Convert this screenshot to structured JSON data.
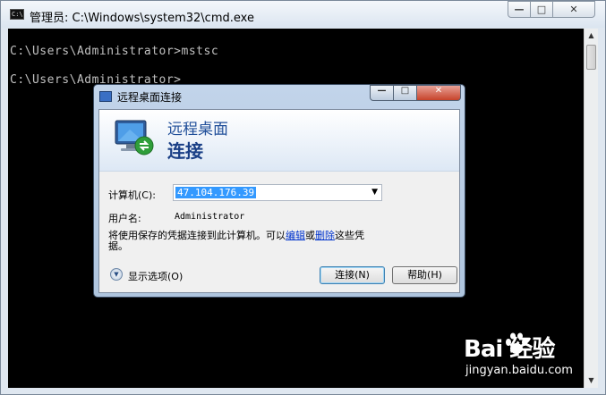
{
  "cmd_window": {
    "title": "管理员: C:\\Windows\\system32\\cmd.exe",
    "icon": "console-icon",
    "buttons": {
      "minimize": "—",
      "maximize": "□",
      "close": "✕"
    },
    "console_lines": [
      "C:\\Users\\Administrator>mstsc",
      "C:\\Users\\Administrator>"
    ]
  },
  "rdp_dialog": {
    "title": "远程桌面连接",
    "icon": "remote-desktop-icon",
    "heading_line1": "远程桌面",
    "heading_line2": "连接",
    "computer_label": "计算机(C):",
    "computer_value": "47.104.176.39",
    "username_label": "用户名:",
    "username_value": "Administrator",
    "info_text_before": "将使用保存的凭据连接到此计算机。可以",
    "info_link_edit": "编辑",
    "info_text_or": "或",
    "info_link_delete": "删除",
    "info_text_after": "这些凭据。",
    "options_label": "显示选项(O)",
    "connect_label": "连接(N)",
    "help_label": "帮助(H)",
    "buttons": {
      "minimize": "—",
      "maximize": "□",
      "close": "✕"
    }
  },
  "watermark": {
    "brand": "Bai  经验",
    "url": "jingyan.baidu.com"
  },
  "colors": {
    "console_bg": "#000000",
    "console_text": "#c0c0c0",
    "selection": "#3399ff",
    "link": "#0033cc",
    "heading": "#1f4e99"
  }
}
